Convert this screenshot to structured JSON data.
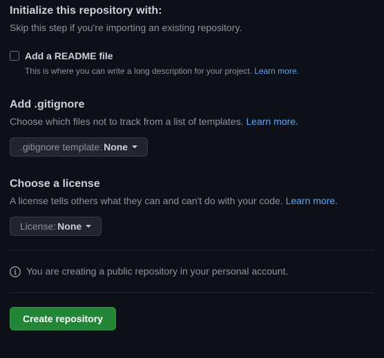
{
  "init": {
    "heading": "Initialize this repository with:",
    "sub": "Skip this step if you're importing an existing repository."
  },
  "readme": {
    "label": "Add a README file",
    "desc": "This is where you can write a long description for your project. ",
    "learn": "Learn more."
  },
  "gitignore": {
    "heading": "Add .gitignore",
    "desc": "Choose which files not to track from a list of templates. ",
    "learn": "Learn more.",
    "dropdown_prefix": ".gitignore template: ",
    "dropdown_value": "None"
  },
  "license": {
    "heading": "Choose a license",
    "desc": "A license tells others what they can and can't do with your code. ",
    "learn": "Learn more.",
    "dropdown_prefix": "License: ",
    "dropdown_value": "None"
  },
  "info": {
    "text": "You are creating a public repository in your personal account."
  },
  "submit": {
    "label": "Create repository"
  }
}
